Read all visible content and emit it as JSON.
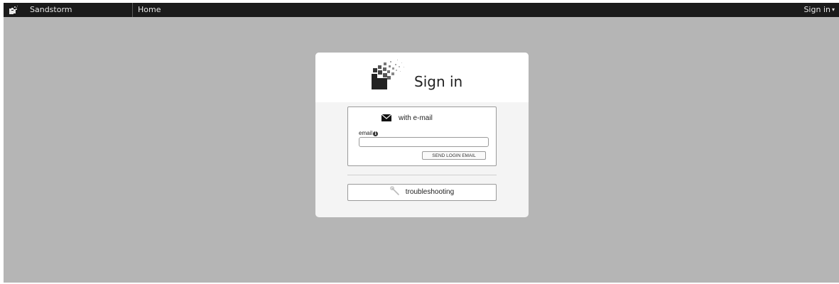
{
  "topbar": {
    "brand_name": "Sandstorm",
    "home_label": "Home",
    "signin_label": "Sign in",
    "signin_chevron": "▾"
  },
  "card": {
    "title": "Sign in",
    "email_section": {
      "header_label": "with e-mail",
      "field_label": "email",
      "info_glyph": "i",
      "input_value": "",
      "input_placeholder": "",
      "send_button_label": "SEND LOGIN EMAIL"
    },
    "troubleshooting_label": "troubleshooting"
  },
  "icons": {
    "brand": "sandstorm-logo-icon",
    "card_logo": "sandstorm-logo-icon",
    "email": "envelope-icon",
    "info": "info-icon",
    "troubleshooting": "wrench-icon",
    "signin_menu": "chevron-down-icon"
  },
  "colors": {
    "topbar_bg": "#1b1b1b",
    "page_bg": "#b5b5b5",
    "card_bg": "#f4f4f4",
    "card_header_bg": "#ffffff"
  }
}
